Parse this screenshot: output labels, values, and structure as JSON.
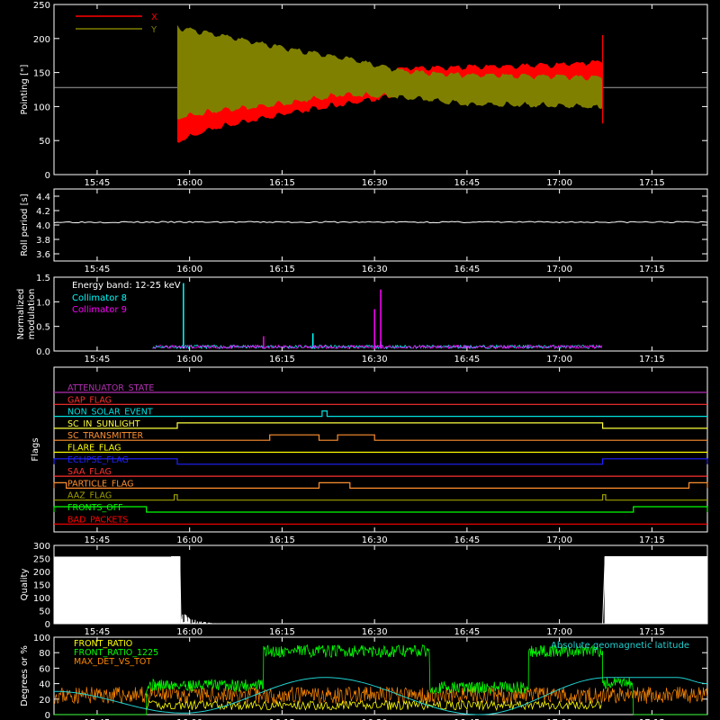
{
  "chart_data": [
    {
      "type": "line",
      "ylabel": "Pointing [\"]",
      "ylim": [
        0,
        250
      ],
      "yticks": [
        0,
        50,
        100,
        150,
        200,
        250
      ],
      "xticks": [
        "15:45",
        "16:00",
        "16:15",
        "16:30",
        "16:45",
        "17:00",
        "17:15"
      ],
      "legend_placement": "top-left",
      "reference_line": 128,
      "series": [
        {
          "name": "X",
          "color": "#ff0000",
          "x": [
            "15:58",
            "16:04",
            "16:15",
            "16:25",
            "16:35",
            "16:45",
            "17:00",
            "17:07"
          ],
          "upper": [
            150,
            165,
            150,
            140,
            160,
            162,
            165,
            170
          ],
          "lower": [
            45,
            65,
            85,
            100,
            115,
            118,
            118,
            115
          ]
        },
        {
          "name": "Y",
          "color": "#808000",
          "x": [
            "15:58",
            "16:04",
            "16:15",
            "16:25",
            "16:35",
            "16:45",
            "17:00",
            "17:07"
          ],
          "upper": [
            220,
            210,
            190,
            175,
            155,
            150,
            148,
            145
          ],
          "lower": [
            80,
            90,
            100,
            115,
            110,
            100,
            98,
            95
          ]
        }
      ]
    },
    {
      "type": "line",
      "ylabel": "Roll period [s]",
      "ylim": [
        3.5,
        4.5
      ],
      "yticks": [
        3.6,
        3.8,
        4.0,
        4.2,
        4.4
      ],
      "xticks": [
        "15:45",
        "16:00",
        "16:15",
        "16:30",
        "16:45",
        "17:00",
        "17:15"
      ],
      "series": [
        {
          "name": "",
          "color": "#ffffff",
          "value": 4.04
        }
      ]
    },
    {
      "type": "line",
      "ylabel": "Normalized modulation",
      "ylim": [
        0,
        1.5
      ],
      "yticks": [
        0.0,
        0.5,
        1.0,
        1.5
      ],
      "xticks": [
        "15:45",
        "16:00",
        "16:15",
        "16:30",
        "16:45",
        "17:00",
        "17:15"
      ],
      "annotation": "Energy band: 12-25 keV",
      "series": [
        {
          "name": "Collimator 8",
          "color": "#00ffff",
          "spikes": [
            [
              "15:59",
              1.38
            ],
            [
              "16:20",
              0.36
            ],
            [
              "16:31",
              0.2
            ]
          ]
        },
        {
          "name": "Collimator 9",
          "color": "#ff00ff",
          "spikes": [
            [
              "16:31",
              1.25
            ],
            [
              "16:30",
              0.85
            ],
            [
              "16:12",
              0.3
            ]
          ]
        }
      ]
    },
    {
      "type": "line",
      "ylabel": "Flags",
      "xticks": [
        "15:45",
        "16:00",
        "16:15",
        "16:30",
        "16:45",
        "17:00",
        "17:15"
      ],
      "flags": [
        {
          "name": "ATTENUATOR_STATE",
          "color": "#b030b0",
          "on": []
        },
        {
          "name": "GAP_FLAG",
          "color": "#ff3030",
          "on": []
        },
        {
          "name": "NON_SOLAR_EVENT",
          "color": "#00e0e0",
          "on": [
            [
              "16:21.5",
              "16:22.3"
            ]
          ]
        },
        {
          "name": "SC_IN_SUNLIGHT",
          "color": "#ffff40",
          "on": [
            [
              "15:58",
              "17:07"
            ]
          ]
        },
        {
          "name": "SC_TRANSMITTER",
          "color": "#ff9030",
          "on": [
            [
              "16:13",
              "16:21"
            ],
            [
              "16:24",
              "16:30"
            ]
          ]
        },
        {
          "name": "FLARE_FLAG",
          "color": "#ffff00",
          "on": []
        },
        {
          "name": "ECLIPSE_FLAG",
          "color": "#2020ff",
          "on": [
            [
              "15:38",
              "15:58"
            ],
            [
              "17:07",
              "17:24"
            ]
          ]
        },
        {
          "name": "SAA_FLAG",
          "color": "#ff3030",
          "on": []
        },
        {
          "name": "PARTICLE_FLAG",
          "color": "#ff9030",
          "on": [
            [
              "15:38",
              "15:40"
            ],
            [
              "16:21",
              "16:26"
            ],
            [
              "17:21",
              "17:24"
            ]
          ]
        },
        {
          "name": "AAZ_FLAG",
          "color": "#a0a000",
          "on": [
            [
              "15:57.5",
              "15:58"
            ],
            [
              "17:07",
              "17:07.5"
            ]
          ]
        },
        {
          "name": "FRONTS_OFF",
          "color": "#00ff00",
          "on": [
            [
              "15:38",
              "15:53"
            ],
            [
              "17:12",
              "17:24"
            ]
          ]
        },
        {
          "name": "BAD_PACKETS",
          "color": "#ff0000",
          "on": []
        }
      ]
    },
    {
      "type": "line",
      "ylabel": "Quality",
      "ylim": [
        0,
        300
      ],
      "yticks": [
        0,
        50,
        100,
        150,
        200,
        250,
        300
      ],
      "xticks": [
        "15:45",
        "16:00",
        "16:15",
        "16:30",
        "16:45",
        "17:00",
        "17:15"
      ],
      "series": [
        {
          "name": "",
          "color": "#ffffff",
          "x": [
            "15:57",
            "15:58.4",
            "15:58.6",
            "16:07",
            "17:07",
            "17:07.4",
            "17:24"
          ],
          "y": [
            257,
            257,
            0,
            0,
            0,
            257,
            257
          ]
        }
      ]
    },
    {
      "type": "line",
      "ylabel": "Degrees or %",
      "ylim": [
        0,
        100
      ],
      "yticks": [
        0,
        20,
        40,
        60,
        80,
        100
      ],
      "xticks": [
        "15:45",
        "16:00",
        "16:15",
        "16:30",
        "16:45",
        "17:00",
        "17:15"
      ],
      "annotation": "Absolute geomagnetic latitude",
      "series": [
        {
          "name": "FRONT_RATIO",
          "color": "#ffff00",
          "y_level": 12
        },
        {
          "name": "FRONT_RATIO_1225",
          "color": "#00ff00",
          "segments": [
            [
              "15:53",
              "16:12",
              38
            ],
            [
              "16:12",
              "16:39",
              82
            ],
            [
              "16:39",
              "16:55",
              35
            ],
            [
              "16:55",
              "17:07",
              82
            ],
            [
              "17:07",
              "17:12",
              40
            ]
          ]
        },
        {
          "name": "MAX_DET_VS_TOT",
          "color": "#ff8800",
          "y_level": 25
        },
        {
          "name": "Absolute geomagnetic latitude",
          "color": "#20d0d0",
          "x": [
            "15:38",
            "15:59",
            "16:22",
            "16:47",
            "17:08",
            "17:19",
            "17:24"
          ],
          "y": [
            30,
            2,
            48,
            0,
            48,
            48,
            40
          ]
        }
      ]
    }
  ]
}
